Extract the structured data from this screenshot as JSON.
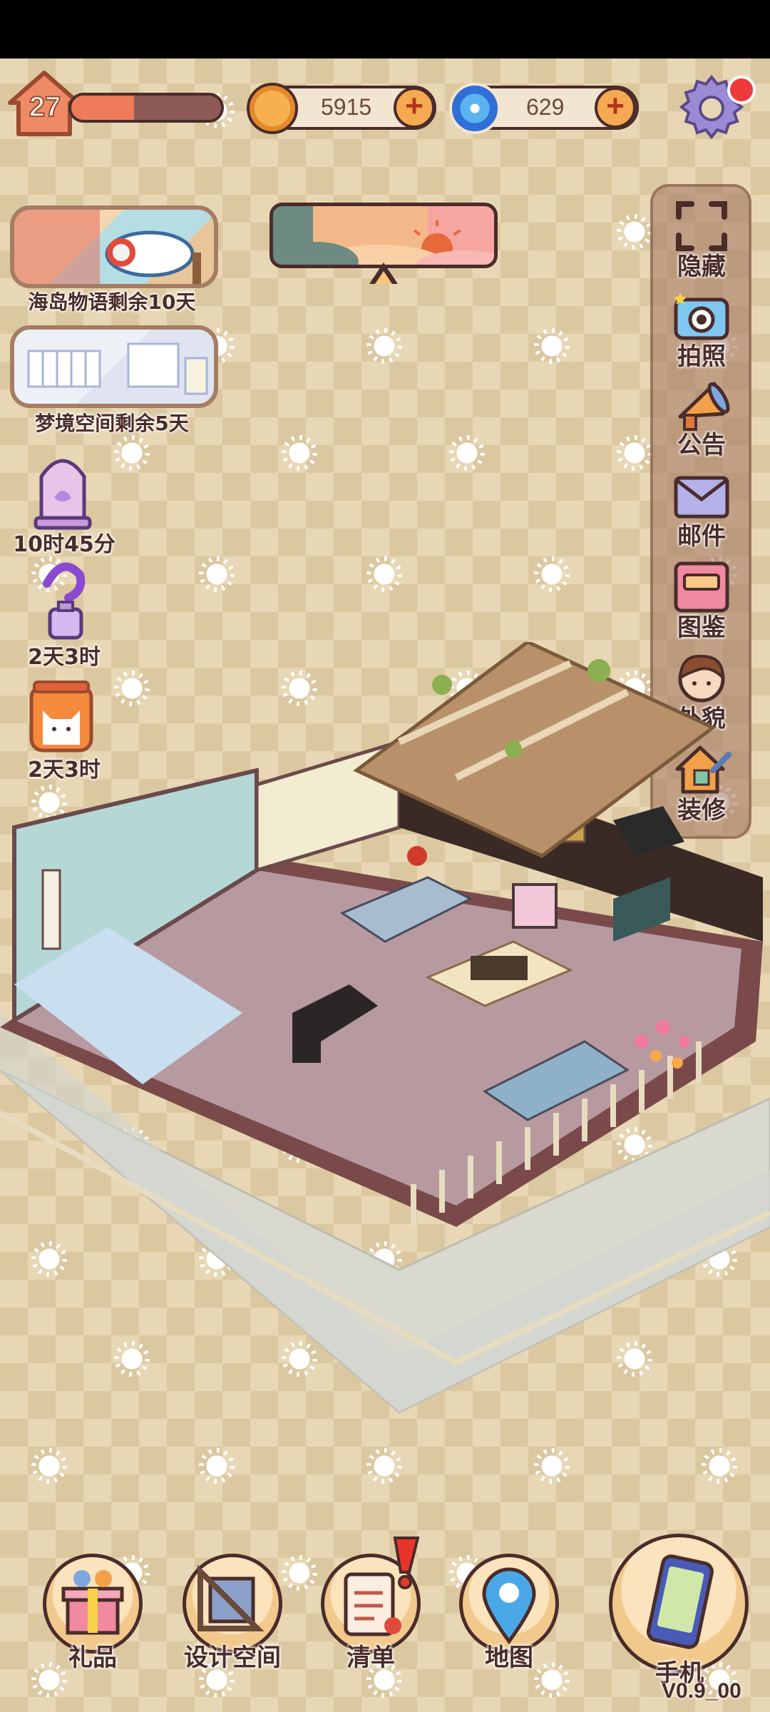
{
  "player": {
    "level": "27",
    "xp_progress": 0.42
  },
  "currencies": [
    {
      "name": "coin",
      "value": "5915",
      "icon": "coin-icon"
    },
    {
      "name": "gem",
      "value": "629",
      "icon": "swirl-gem-icon"
    }
  ],
  "settings": {
    "icon": "gear-icon",
    "has_notification": true
  },
  "events": [
    {
      "label": "海岛物语剩余10天"
    },
    {
      "label": "梦境空间剩余5天"
    }
  ],
  "timers": [
    {
      "label": "10时45分",
      "icon": "bell-jar-icon"
    },
    {
      "label": "2天3时",
      "icon": "potion-icon"
    },
    {
      "label": "2天3时",
      "icon": "cat-jar-icon"
    }
  ],
  "side_menu": [
    {
      "label": "隐藏",
      "icon": "hide-frame-icon"
    },
    {
      "label": "拍照",
      "icon": "camera-icon"
    },
    {
      "label": "公告",
      "icon": "megaphone-icon"
    },
    {
      "label": "邮件",
      "icon": "mail-icon"
    },
    {
      "label": "图鉴",
      "icon": "album-icon"
    },
    {
      "label": "外貌",
      "icon": "avatar-icon"
    },
    {
      "label": "装修",
      "icon": "renovate-icon"
    }
  ],
  "bottom_nav": [
    {
      "label": "礼品",
      "icon": "gift-icon"
    },
    {
      "label": "设计空间",
      "icon": "design-ruler-icon"
    },
    {
      "label": "清单",
      "icon": "checklist-icon",
      "alert": "!"
    },
    {
      "label": "地图",
      "icon": "map-pin-icon"
    },
    {
      "label": "手机",
      "icon": "phone-icon"
    }
  ],
  "version": "V0.9_00"
}
